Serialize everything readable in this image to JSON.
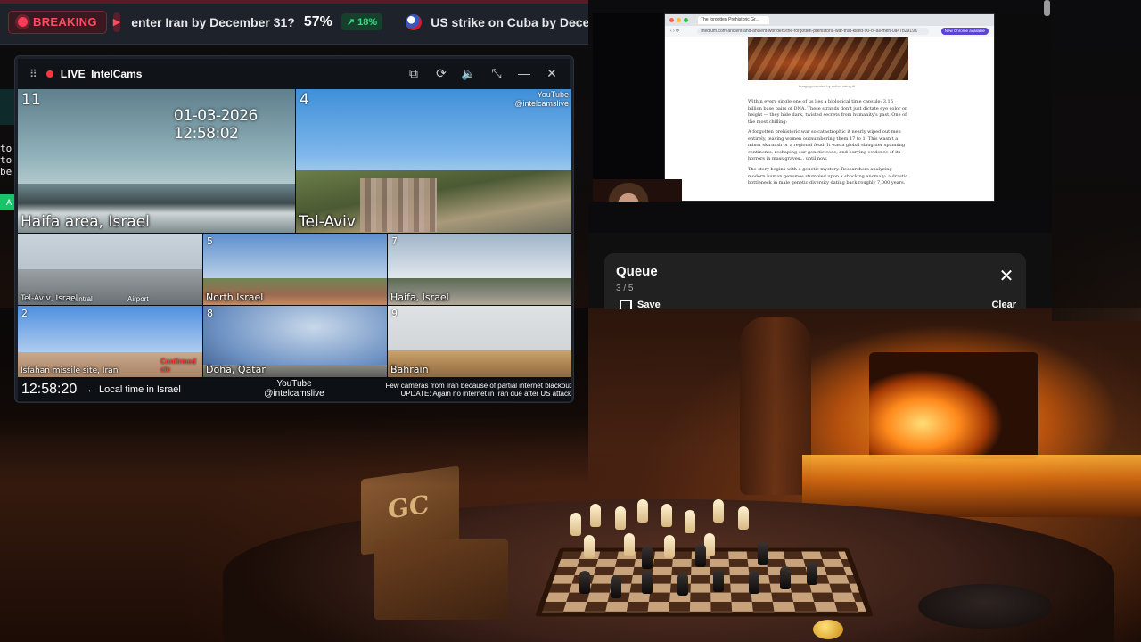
{
  "ticker": {
    "breaking_label": "BREAKING",
    "items": [
      {
        "question": "enter Iran by December 31?",
        "percent": "57%",
        "delta": "18%",
        "delta_direction": "up"
      },
      {
        "question": "US strike on Cuba by Dece",
        "flag": "us-flag-icon"
      }
    ],
    "colors": {
      "breaking": "#ff4b62",
      "delta_up": "#3ddc84"
    }
  },
  "intelcams": {
    "live_label": "LIVE",
    "title": "IntelCams",
    "tools": [
      "external-link-icon",
      "refresh-icon",
      "mute-icon",
      "minimize-arrows-icon",
      "minimize-icon",
      "close-icon"
    ],
    "cams": [
      {
        "number": "11",
        "label": "Haifa area, Israel",
        "timestamp": "01-03-2026 12:58:02"
      },
      {
        "number": "4",
        "label": "Tel-Aviv",
        "watermark": "YouTube\n@intelcamslive"
      },
      {
        "number": "",
        "label": "Tel-Aviv, Israel",
        "extra": [
          "Central",
          "Airport"
        ]
      },
      {
        "number": "5",
        "label": "North Israel"
      },
      {
        "number": "7",
        "label": "Haifa, Israel"
      },
      {
        "number": "2",
        "label": "Isfahan missile site, Iran",
        "extra": [
          "Confirmed cle"
        ]
      },
      {
        "number": "8",
        "label": "Doha, Qatar"
      },
      {
        "number": "9",
        "label": "Bahrain"
      }
    ],
    "footer": {
      "clock": "12:58:20",
      "local_label": "← Local time in Israel",
      "youtube": "YouTube",
      "handle": "@intelcamslive",
      "note_line1": "Few cameras from Iran because of partial internet blackout",
      "note_line2": "UPDATE: Again no internet in Iran due after US attack"
    }
  },
  "edge": {
    "lines": [
      "to",
      "to",
      "be"
    ]
  },
  "browser": {
    "tab_title": "The forgotten Prehistoric Gr...",
    "url": "medium.com/ancient-and-ancient-wonders/the-forgotten-prehistoric-war-that-killed-90-of-all-men-0a47b2919a",
    "action_button": "New Chrome available",
    "caption": "Image generated by author using AI",
    "paragraphs": [
      "Within every single one of us lies a biological time capsule: 3.16 billion base pairs of DNA. These strands don't just dictate eye color or height — they hide dark, twisted secrets from humanity's past. One of the most chilling:",
      "A forgotten prehistoric war so catastrophic it nearly wiped out men entirely, leaving women outnumbering them 17 to 1. This wasn't a minor skirmish or a regional feud. It was a global slaughter spanning continents, reshaping our genetic code, and burying evidence of its horrors in mass graves... until now.",
      "The story begins with a genetic mystery. Researchers analyzing modern human genomes stumbled upon a shocking anomaly: a drastic bottleneck in male genetic diversity dating back roughly 7,000 years."
    ]
  },
  "queue": {
    "title": "Queue",
    "count": "3 / 5",
    "save_label": "Save",
    "clear_label": "Clear"
  },
  "scene": {
    "box_letters": "GC"
  }
}
